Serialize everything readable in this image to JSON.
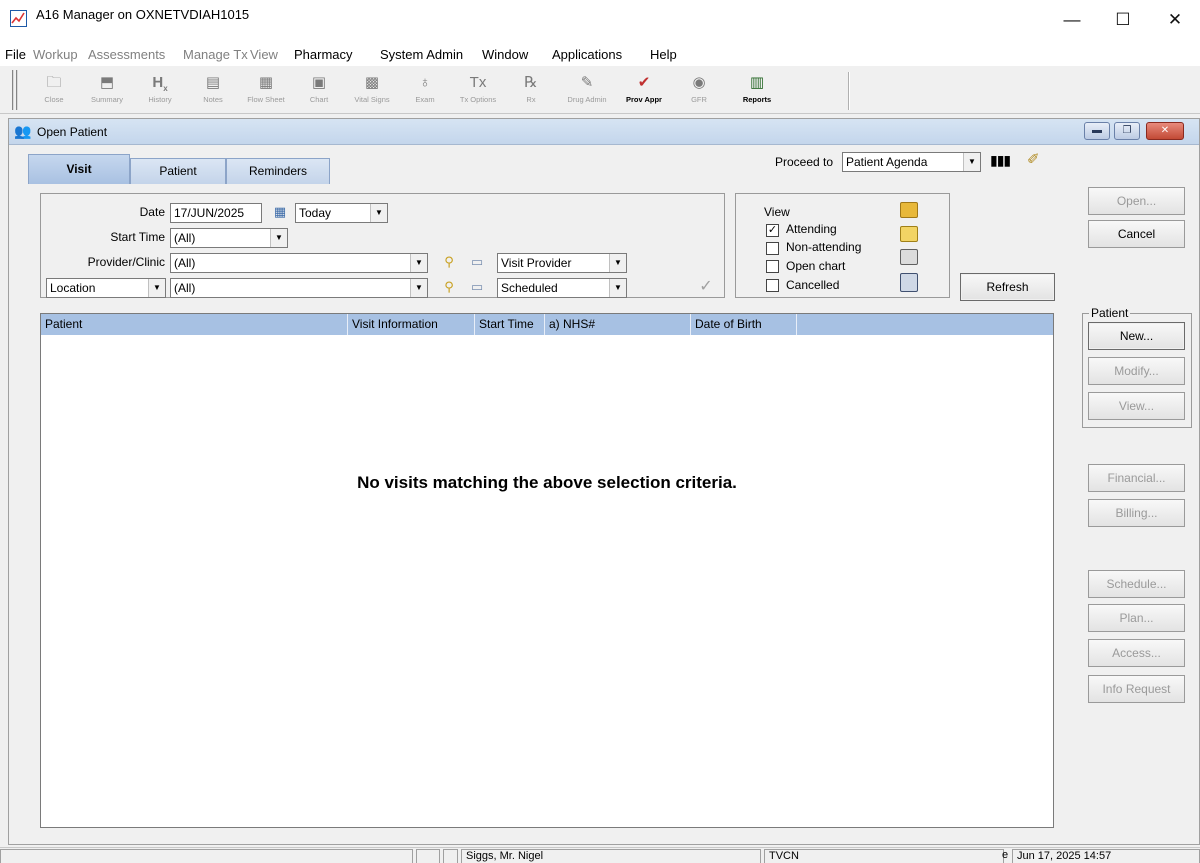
{
  "window": {
    "title": "A16 Manager on OXNETVDIAH1015",
    "controls": {
      "minimize": "—",
      "maximize": "☐",
      "close": "✕"
    }
  },
  "menubar": [
    {
      "label": "File",
      "enabled": true
    },
    {
      "label": "Workup",
      "enabled": false
    },
    {
      "label": "Assessments",
      "enabled": false
    },
    {
      "label": "Manage Tx",
      "enabled": false
    },
    {
      "label": "View",
      "enabled": false
    },
    {
      "label": "Pharmacy",
      "enabled": true
    },
    {
      "label": "System Admin",
      "enabled": true
    },
    {
      "label": "Window",
      "enabled": true
    },
    {
      "label": "Applications",
      "enabled": true
    },
    {
      "label": "Help",
      "enabled": true
    }
  ],
  "toolbar": [
    {
      "label": "Close",
      "icon": "folder-icon",
      "enabled": false
    },
    {
      "label": "Summary",
      "icon": "summary-icon",
      "enabled": false
    },
    {
      "label": "History",
      "icon": "history-icon",
      "enabled": false
    },
    {
      "label": "Notes",
      "icon": "notes-icon",
      "enabled": false
    },
    {
      "label": "Flow Sheet",
      "icon": "flowsheet-icon",
      "enabled": false
    },
    {
      "label": "Chart",
      "icon": "chart-icon",
      "enabled": false
    },
    {
      "label": "Vital Signs",
      "icon": "vitalsigns-icon",
      "enabled": false
    },
    {
      "label": "Exam",
      "icon": "stethoscope-icon",
      "enabled": false
    },
    {
      "label": "Tx Options",
      "icon": "txoptions-icon",
      "enabled": false
    },
    {
      "label": "Rx",
      "icon": "rx-icon",
      "enabled": false
    },
    {
      "label": "Drug Admin",
      "icon": "drugadmin-icon",
      "enabled": false
    },
    {
      "label": "Prov Appr",
      "icon": "provappr-icon",
      "enabled": true
    },
    {
      "label": "GFR",
      "icon": "gfr-icon",
      "enabled": false
    },
    {
      "label": "Reports",
      "icon": "reports-icon",
      "enabled": true
    }
  ],
  "child_window": {
    "title": "Open Patient",
    "controls": {
      "minimize": "▬",
      "restore": "❐",
      "close": "✕"
    }
  },
  "tabs": [
    {
      "label": "Visit",
      "active": true
    },
    {
      "label": "Patient",
      "active": false
    },
    {
      "label": "Reminders",
      "active": false
    }
  ],
  "proceed_to": {
    "label": "Proceed to",
    "value": "Patient Agenda"
  },
  "filters": {
    "date_label": "Date",
    "date_value": "17/JUN/2025",
    "date_preset": "Today",
    "start_time_label": "Start Time",
    "start_time_value": "(All)",
    "provider_label": "Provider/Clinic",
    "provider_value": "(All)",
    "provider_type": "Visit Provider",
    "location_field": "Location",
    "location_value": "(All)",
    "visit_status": "Scheduled"
  },
  "view": {
    "label": "View",
    "options": [
      {
        "label": "Attending",
        "checked": true
      },
      {
        "label": "Non-attending",
        "checked": false
      },
      {
        "label": "Open chart",
        "checked": false
      },
      {
        "label": "Cancelled",
        "checked": false
      }
    ]
  },
  "buttons": {
    "refresh": "Refresh",
    "open": "Open...",
    "cancel": "Cancel",
    "patient_group": "Patient",
    "new": "New...",
    "modify": "Modify...",
    "view": "View...",
    "financial": "Financial...",
    "billing": "Billing...",
    "schedule": "Schedule...",
    "plan": "Plan...",
    "access": "Access...",
    "info_request": "Info Request"
  },
  "list": {
    "columns": [
      "Patient",
      "Visit Information",
      "Start Time",
      "a) NHS#",
      "Date of Birth",
      ""
    ],
    "empty_message": "No visits matching the above selection criteria."
  },
  "status_bar": {
    "user": "Siggs, Mr. Nigel",
    "site": "TVCN",
    "indicator": "e",
    "datetime": "Jun 17, 2025 14:57"
  }
}
